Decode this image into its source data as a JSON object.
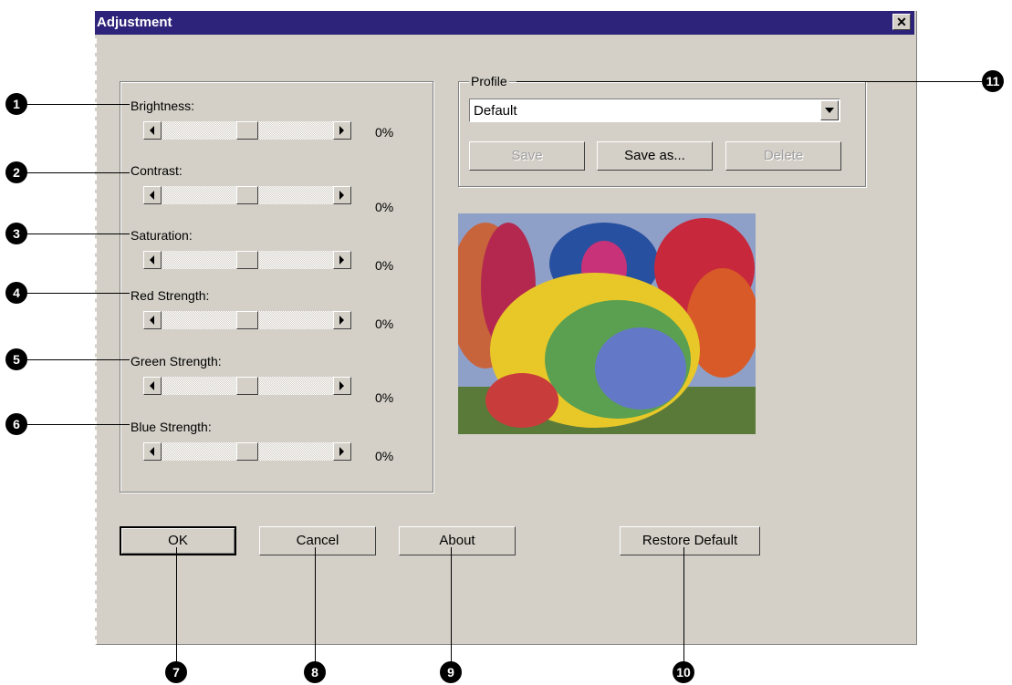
{
  "window": {
    "title": "Adjustment",
    "close_label": "✕"
  },
  "sliders": [
    {
      "label": "Brightness:",
      "value": "0%",
      "level": 0
    },
    {
      "label": "Contrast:",
      "value": "0%",
      "level": 0
    },
    {
      "label": "Saturation:",
      "value": "0%",
      "level": 0
    },
    {
      "label": "Red Strength:",
      "value": "0%",
      "level": 0
    },
    {
      "label": "Green Strength:",
      "value": "0%",
      "level": 0
    },
    {
      "label": "Blue Strength:",
      "value": "0%",
      "level": 0
    }
  ],
  "profile": {
    "group_label": "Profile",
    "selected": "Default",
    "save_label": "Save",
    "save_as_label": "Save as...",
    "delete_label": "Delete"
  },
  "buttons": {
    "ok": "OK",
    "cancel": "Cancel",
    "about": "About",
    "restore": "Restore Default"
  },
  "callouts": [
    "1",
    "2",
    "3",
    "4",
    "5",
    "6",
    "7",
    "8",
    "9",
    "10",
    "11"
  ],
  "colors": {
    "titlebar": "#2e237a",
    "dialog": "#d4d0c8"
  }
}
